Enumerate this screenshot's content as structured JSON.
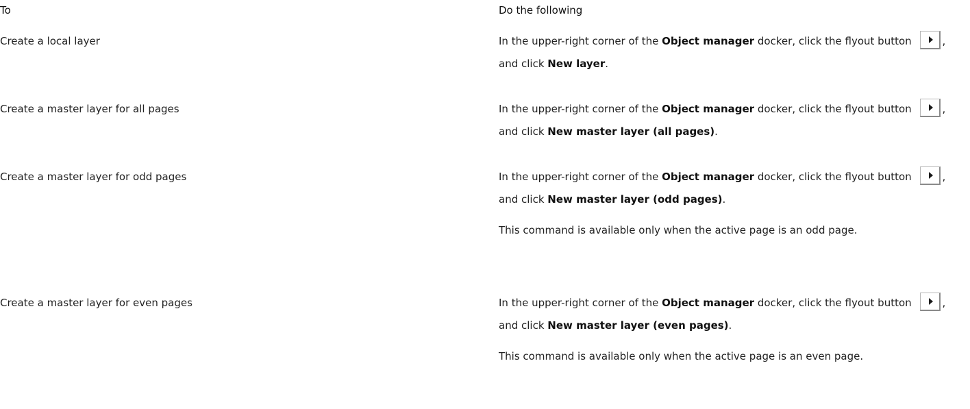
{
  "header": {
    "col_to": "To",
    "col_do": "Do the following"
  },
  "icons": {
    "flyout": "flyout-button-icon"
  },
  "rows": [
    {
      "task": "Create a local layer",
      "instr_prefix": "In the upper-right corner of the ",
      "docker": "Object manager",
      "instr_mid": " docker, click the flyout button ",
      "instr_after": ", and click ",
      "command": "New layer",
      "instr_end": ".",
      "note": ""
    },
    {
      "task": "Create a master layer for all pages",
      "instr_prefix": "In the upper-right corner of the ",
      "docker": "Object manager",
      "instr_mid": " docker, click the flyout button ",
      "instr_after": ", and click ",
      "command": "New master layer (all pages)",
      "instr_end": ".",
      "note": ""
    },
    {
      "task": "Create a master layer for odd pages",
      "instr_prefix": "In the upper-right corner of the ",
      "docker": "Object manager",
      "instr_mid": " docker, click the flyout button ",
      "instr_after": ", and click ",
      "command": "New master layer (odd pages)",
      "instr_end": ".",
      "note": "This command is available only when the active page is an odd page."
    },
    {
      "task": "Create a master layer for even pages",
      "instr_prefix": "In the upper-right corner of the ",
      "docker": "Object manager",
      "instr_mid": " docker, click the flyout button ",
      "instr_after": ", and click ",
      "command": "New master layer (even pages)",
      "instr_end": ".",
      "note": "This command is available only when the active page is an even page."
    }
  ]
}
